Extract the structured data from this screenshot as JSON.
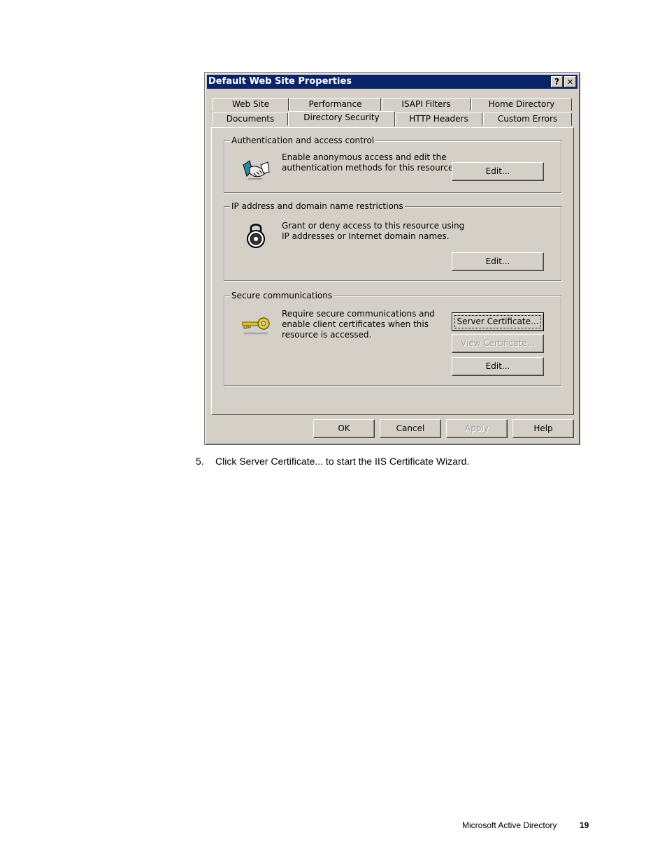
{
  "dialog": {
    "title": "Default Web Site Properties",
    "help_label": "?",
    "close_label": "✕",
    "tabs_row1": [
      "Web Site",
      "Performance",
      "ISAPI Filters",
      "Home Directory"
    ],
    "tabs_row2": [
      "Documents",
      "Directory Security",
      "HTTP Headers",
      "Custom Errors"
    ],
    "active_tab": "Directory Security",
    "groups": {
      "auth": {
        "title": "Authentication and access control",
        "line1": "Enable anonymous access and edit the",
        "line2": "authentication methods for this resource.",
        "edit": "Edit..."
      },
      "ip": {
        "title": "IP address and domain name restrictions",
        "line1": "Grant or deny access to this resource using",
        "line2": "IP addresses or Internet domain names.",
        "edit": "Edit..."
      },
      "secure": {
        "title": "Secure communications",
        "line1": "Require secure communications and",
        "line2": "enable client certificates when this",
        "line3": "resource is accessed.",
        "server_cert": "Server Certificate...",
        "view_cert": "View Certificate...",
        "edit": "Edit..."
      }
    },
    "buttons": {
      "ok": "OK",
      "cancel": "Cancel",
      "apply": "Apply",
      "help": "Help"
    }
  },
  "caption": {
    "number": "5.",
    "text": "Click Server Certificate... to start the IIS Certificate Wizard."
  },
  "footer": {
    "title": "Microsoft Active Directory",
    "page": "19"
  }
}
